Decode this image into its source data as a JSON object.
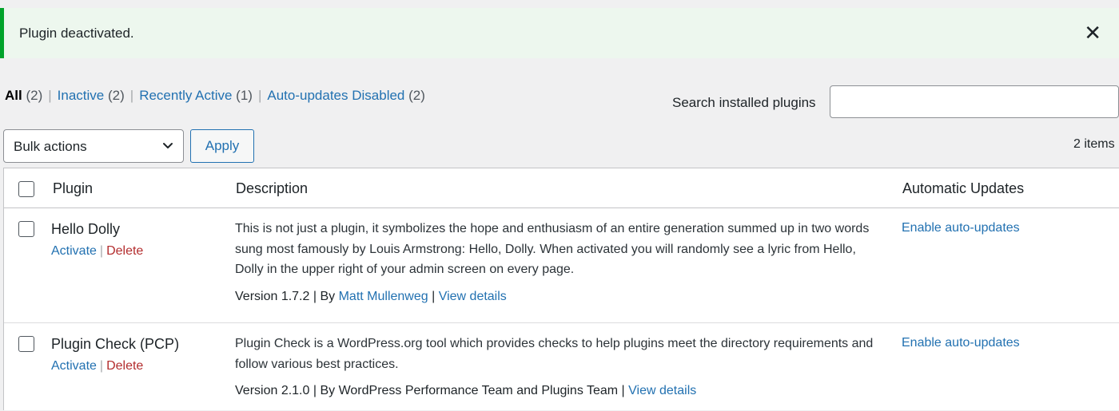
{
  "notice": {
    "text": "Plugin deactivated."
  },
  "filters": [
    {
      "label": "All",
      "count": "(2)",
      "current": true
    },
    {
      "label": "Inactive",
      "count": "(2)",
      "current": false
    },
    {
      "label": "Recently Active",
      "count": "(1)",
      "current": false
    },
    {
      "label": "Auto-updates Disabled",
      "count": "(2)",
      "current": false
    }
  ],
  "filter_separator": "|",
  "search": {
    "label": "Search installed plugins",
    "value": ""
  },
  "bulk": {
    "selected": "Bulk actions",
    "apply_label": "Apply"
  },
  "items_count": "2 items",
  "table": {
    "headers": {
      "plugin": "Plugin",
      "description": "Description",
      "auto_updates": "Automatic Updates"
    },
    "rows": [
      {
        "name": "Hello Dolly",
        "activate": "Activate",
        "delete": "Delete",
        "description": "This is not just a plugin, it symbolizes the hope and enthusiasm of an entire generation summed up in two words sung most famously by Louis Armstrong: Hello, Dolly. When activated you will randomly see a lyric from Hello, Dolly in the upper right of your admin screen on every page.",
        "version": "Version 1.7.2",
        "by": "By",
        "author": "Matt Mullenweg",
        "author_is_link": true,
        "view_details": "View details",
        "auto_update": "Enable auto-updates"
      },
      {
        "name": "Plugin Check (PCP)",
        "activate": "Activate",
        "delete": "Delete",
        "description": "Plugin Check is a WordPress.org tool which provides checks to help plugins meet the directory requirements and follow various best practices.",
        "version": "Version 2.1.0",
        "by": "By",
        "author": "WordPress Performance Team and Plugins Team",
        "author_is_link": false,
        "view_details": "View details",
        "auto_update": "Enable auto-updates"
      }
    ]
  },
  "colors": {
    "link": "#2271b1",
    "delete": "#b32d2e",
    "notice_border": "#00a32a",
    "notice_bg": "#edf7ee",
    "page_bg": "#f0f0f1"
  }
}
